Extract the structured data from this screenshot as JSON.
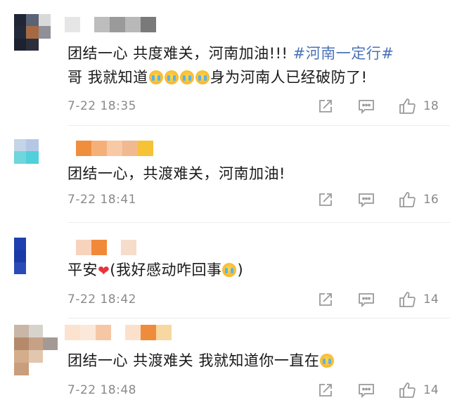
{
  "comments": [
    {
      "text_1": "团结一心 共度难关，河南加油!!! ",
      "hashtag": "#河南一定行#",
      "text_2": "哥 我就知道",
      "text_3": "身为河南人已经破防了!",
      "time": "7-22 18:35",
      "likes": "18"
    },
    {
      "text": "团结一心，共渡难关，河南加油!",
      "time": "7-22 18:41",
      "likes": "16"
    },
    {
      "text_1": "平安",
      "text_2": "(我好感动咋回事",
      "text_3": ")",
      "time": "7-22 18:42",
      "likes": "14"
    },
    {
      "text": "团结一心 共渡难关 我就知道你一直在",
      "time": "7-22 18:48",
      "likes": "14"
    }
  ],
  "icons": {
    "share": "share-icon",
    "comment": "comment-icon",
    "like": "thumbs-up-icon",
    "emoji": "crying-face-emoji",
    "heart": "red-heart"
  },
  "colors": {
    "hashtag": "#4a73b8",
    "meta_text": "#8a8a8a",
    "icon_stroke": "#9a9a9a",
    "heart": "#e8333a"
  }
}
